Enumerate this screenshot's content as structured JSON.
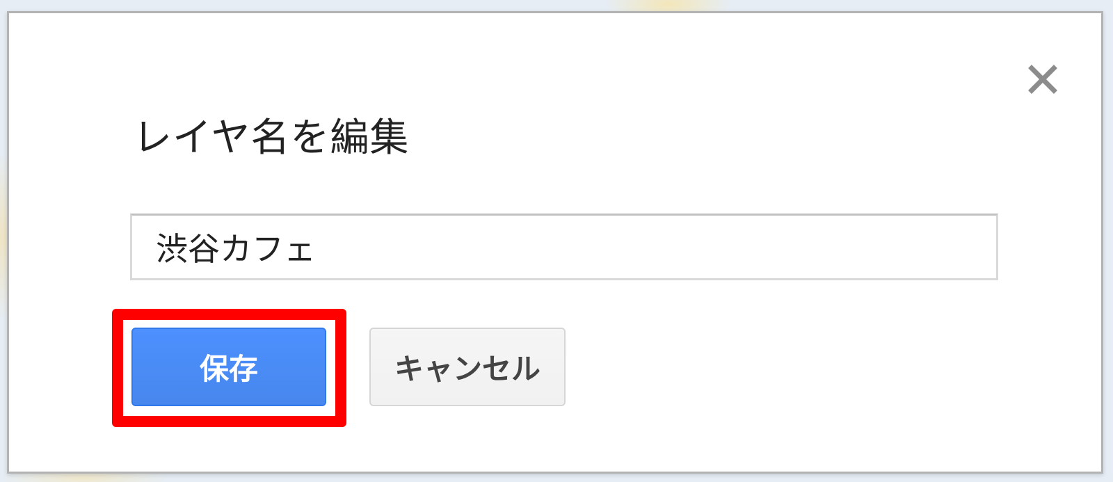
{
  "dialog": {
    "title": "レイヤ名を編集",
    "layer_name_value": "渋谷カフェ",
    "save_label": "保存",
    "cancel_label": "キャンセル",
    "close_icon": "close-icon"
  },
  "colors": {
    "save_button": "#4d90fe",
    "highlight": "#ff0000",
    "cancel_button": "#f1f1f1"
  }
}
